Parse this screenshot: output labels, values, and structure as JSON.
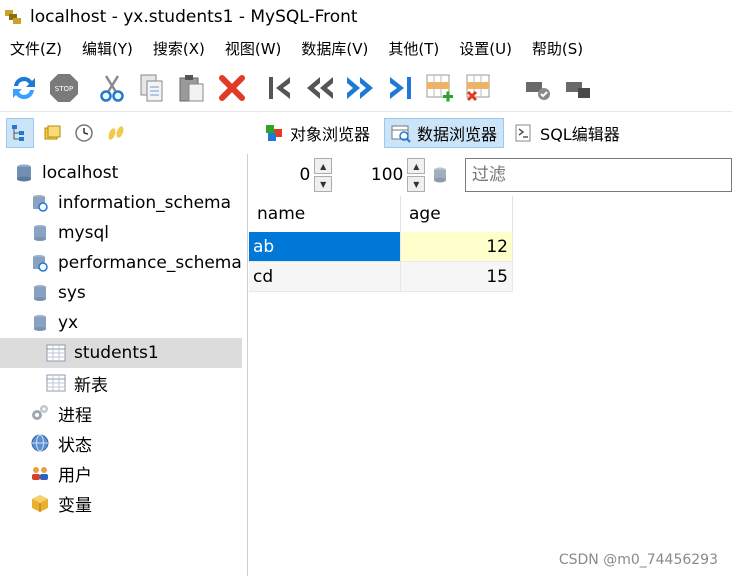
{
  "window": {
    "title": "localhost - yx.students1 - MySQL-Front"
  },
  "menu": [
    {
      "label": "文件(Z)"
    },
    {
      "label": "编辑(Y)"
    },
    {
      "label": "搜索(X)"
    },
    {
      "label": "视图(W)"
    },
    {
      "label": "数据库(V)"
    },
    {
      "label": "其他(T)"
    },
    {
      "label": "设置(U)"
    },
    {
      "label": "帮助(S)"
    }
  ],
  "toolbar": {
    "icons": [
      "refresh-icon",
      "stop-icon",
      "cut-icon",
      "copy-icon",
      "paste-icon",
      "delete-icon",
      "first-record-icon",
      "previous-record-icon",
      "next-record-icon",
      "last-record-icon",
      "insert-record-icon",
      "delete-record-icon",
      "post-icon",
      "cancel-icon"
    ],
    "stop_label": "STOP"
  },
  "views": {
    "object_browser": "对象浏览器",
    "data_browser": "数据浏览器",
    "sql_editor": "SQL编辑器"
  },
  "tree": {
    "root": "localhost",
    "databases": [
      "information_schema",
      "mysql",
      "performance_schema",
      "sys",
      "yx"
    ],
    "tables": [
      "students1",
      "新表"
    ],
    "extras": [
      "进程",
      "状态",
      "用户",
      "变量"
    ]
  },
  "data_nav": {
    "offset": "0",
    "limit": "100",
    "filter_placeholder": "过滤"
  },
  "grid": {
    "columns": [
      "name",
      "age"
    ],
    "rows": [
      {
        "name": "ab",
        "age": "12"
      },
      {
        "name": "cd",
        "age": "15"
      }
    ]
  },
  "watermark": "CSDN @m0_74456293",
  "colors": {
    "selection_blue": "#0078d7",
    "selection_yellow": "#ffffcc",
    "tree_selected": "#dcdcdc",
    "active_tab": "#cce4f7"
  }
}
